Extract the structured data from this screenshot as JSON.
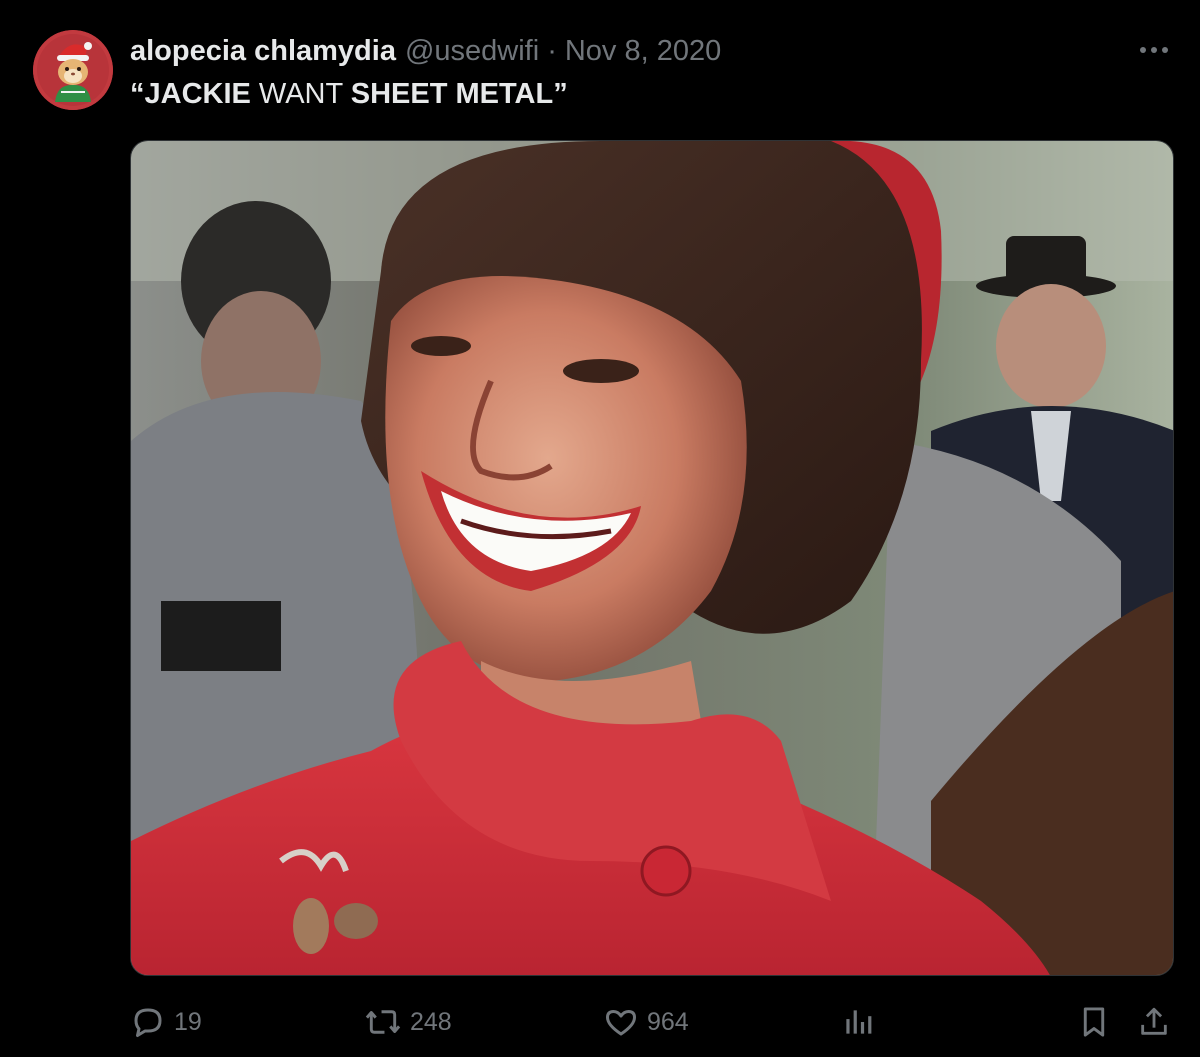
{
  "author": {
    "display_name": "alopecia chlamydia",
    "handle": "@usedwifi",
    "separator": "·",
    "date": "Nov 8, 2020"
  },
  "tweet": {
    "text_open_quote": "“",
    "text_part1": "JACKIE",
    "text_part2": " WANT ",
    "text_part3": "SHEET METAL",
    "text_close_quote": "”"
  },
  "media": {
    "description_icon": "photo"
  },
  "actions": {
    "reply_count": "19",
    "retweet_count": "248",
    "like_count": "964",
    "views_count": "",
    "reply_icon": "speech-bubble",
    "retweet_icon": "retweet-arrows",
    "like_icon": "heart",
    "views_icon": "bar-chart",
    "bookmark_icon": "bookmark",
    "share_icon": "upload-arrow"
  },
  "colors": {
    "background": "#000000",
    "text_primary": "#e7e9ea",
    "text_secondary": "#71767b",
    "border": "#2f3336"
  }
}
